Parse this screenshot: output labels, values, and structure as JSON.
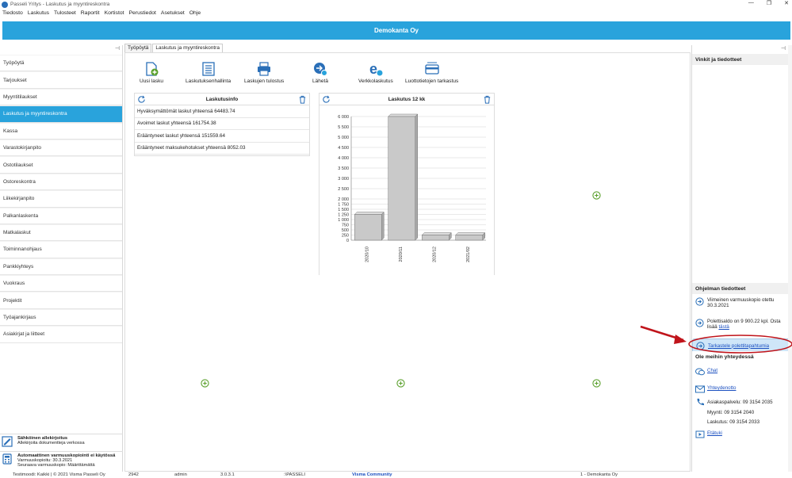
{
  "window": {
    "title": "Passeli Yritys - Laskutus ja myyntireskontra",
    "controls": [
      "—",
      "❐",
      "✕"
    ]
  },
  "menu": [
    "Tiedosto",
    "Laskutus",
    "Tulosteet",
    "Raportit",
    "Kortistot",
    "Perustiedot",
    "Asetukset",
    "Ohje"
  ],
  "banner": {
    "company": "Demokanta Oy",
    "color": "#29a3dc"
  },
  "sidebar": {
    "pin": "⊣",
    "items": [
      {
        "label": "Työpöytä",
        "active": false
      },
      {
        "label": "Tarjoukset",
        "active": false
      },
      {
        "label": "Myyntitilaukset",
        "active": false
      },
      {
        "label": "Laskutus ja myyntireskontra",
        "active": true
      },
      {
        "label": "Kassa",
        "active": false
      },
      {
        "label": "Varastokirjanpito",
        "active": false
      },
      {
        "label": "Ostotilaukset",
        "active": false
      },
      {
        "label": "Ostoreskontra",
        "active": false
      },
      {
        "label": "Liikekirjanpito",
        "active": false
      },
      {
        "label": "Palkanlaskenta",
        "active": false
      },
      {
        "label": "Matkalaskut",
        "active": false
      },
      {
        "label": "Toiminnanohjaus",
        "active": false
      },
      {
        "label": "Pankkiyhteys",
        "active": false
      },
      {
        "label": "Vuokraus",
        "active": false
      },
      {
        "label": "Projektit",
        "active": false
      },
      {
        "label": "Työajankirjaus",
        "active": false
      },
      {
        "label": "Asiakirjat ja liitteet",
        "active": false
      }
    ],
    "notices": [
      {
        "title": "Sähköinen allekirjoitus",
        "lines": [
          "Allekirjoita dokumentteja verkossa"
        ],
        "icon": "signature-icon"
      },
      {
        "title": "Automaattinen varmuuskopiointi ei käytössä",
        "lines": [
          "Varmuuskopioitu: 30.3.2021",
          "Seuraava varmuuskopio: Määrittämättä"
        ],
        "icon": "calculator-icon"
      }
    ]
  },
  "tabs": [
    {
      "label": "Työpöytä",
      "active": false
    },
    {
      "label": "Laskutus ja myyntireskontra",
      "active": true
    }
  ],
  "toolbar": [
    {
      "label": "Uusi lasku",
      "icon": "new-invoice-icon"
    },
    {
      "label": "Laskutuksenhallinta",
      "icon": "list-icon"
    },
    {
      "label": "Laskujen tulostus",
      "icon": "printer-icon"
    },
    {
      "label": "Lähetä",
      "icon": "send-icon"
    },
    {
      "label": "Verkkolaskutus",
      "icon": "e-invoice-icon"
    },
    {
      "label": "Luottotietojen tarkastus",
      "icon": "credit-card-icon"
    }
  ],
  "laskutusinfo": {
    "title": "Laskutusinfo",
    "rows": [
      "Hyväksymättömät laskut yhteensä 64483.74",
      "Avoimet laskut yhteensä 161754.38",
      "Erääntyneet laskut yhteensä 151559.64",
      "Erääntyneet maksukehotukset yhteensä 8052.03"
    ]
  },
  "chart_panel": {
    "title": "Laskutus 12 kk"
  },
  "chart_data": {
    "type": "bar",
    "title": "Laskutus 12 kk",
    "categories": [
      "2020/10",
      "2020/11",
      "2020/12",
      "2021/02"
    ],
    "values": [
      1250,
      6000,
      250,
      250
    ],
    "ylim": [
      0,
      6000
    ],
    "yticks": [
      0,
      250,
      500,
      750,
      1000,
      1250,
      1500,
      1750,
      2000,
      2500,
      3000,
      3500,
      4000,
      4500,
      5000,
      5500,
      6000
    ],
    "ytick_labels": [
      "0",
      "250",
      "500",
      "750",
      "1 000",
      "1 250",
      "1 500",
      "1 750",
      "2 000",
      "2 500",
      "3 000",
      "3 500",
      "4 000",
      "4 500",
      "5 000",
      "5 500",
      "6 000"
    ],
    "bar_color": "#c9c9c9",
    "grid": true,
    "xlabel": "",
    "ylabel": ""
  },
  "right_panel": {
    "pin": "⊣",
    "tips_title": "Vinkit ja tiedotteet",
    "news_title": "Ohjelman tiedotteet",
    "news": [
      {
        "text": "Viimeinen varmuuskopio otettu 30.3.2021"
      },
      {
        "text": "Polettisaldo on 9 900.22 kpl. Osta lisää ",
        "link": "tästä"
      },
      {
        "text": "",
        "link": "Tarkastele polettitapahtumia"
      }
    ],
    "contact_title": "Ole meihin yhteydessä",
    "contacts": {
      "chat": "Chat",
      "email": "Yhteydenotto",
      "phone_lines": [
        "Asiakaspalvelu: 09 3154 2035",
        "Myynti: 09 3154 2040",
        "Laskutus: 09 3154 2033"
      ],
      "remote": "Etätuki"
    }
  },
  "statusbar": {
    "items": [
      "Testimoodi: Kaikki | © 2021 Visma Passeli Oy",
      "2942",
      "admin",
      "3.0.3.1",
      ":\\PASSELI",
      "Visma Community",
      "1 - Demokanta Oy"
    ],
    "link_color": "#1a4fc0"
  },
  "colors": {
    "accent": "#29a3dc",
    "green": "#5aa02c",
    "annotation": "#c0141b"
  }
}
